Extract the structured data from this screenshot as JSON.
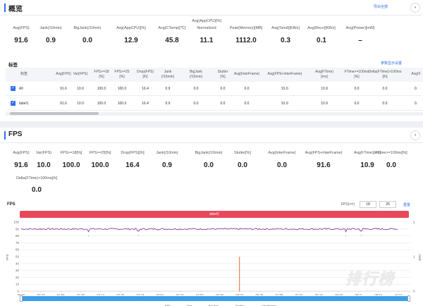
{
  "overview": {
    "title": "概览",
    "export_label": "导出全部",
    "collapse_icon": "chevron-down-icon",
    "metrics": [
      {
        "label": "Avg(FPS)",
        "value": "91.6"
      },
      {
        "label": "Jank(/10min)",
        "value": "0.9"
      },
      {
        "label": "BigJank(/10min)",
        "value": "0.0"
      },
      {
        "label": "Avg(AppCPU)[%]",
        "value": "12.9"
      },
      {
        "label": "Avg(CTemp)[℃]",
        "value": "45.8"
      },
      {
        "label": "Avg(AppCPU)[%]",
        "label2": "Normalized",
        "value": "11.1"
      },
      {
        "label": "Peak(Memory)[MB]",
        "value": "1112.0"
      },
      {
        "label": "Avg(Send)[KB/s]",
        "value": "0.3"
      },
      {
        "label": "Avg(Recv)[KB/s]",
        "value": "0.1"
      },
      {
        "label": "Avg(Power)[mW]",
        "value": "–"
      }
    ],
    "table": {
      "title": "标签",
      "settings_label": "参数显示设置",
      "headers": [
        [
          "标签"
        ],
        [
          "Avg(FPS)"
        ],
        [
          "Var(FPS)"
        ],
        [
          "FPS>=18",
          "[%]"
        ],
        [
          "FPS>=25",
          "[%]"
        ],
        [
          "Drop(FPS)",
          "[/h]"
        ],
        [
          "Jank",
          "(/10min)"
        ],
        [
          "BigJank",
          "(/10min)"
        ],
        [
          "Stutter",
          "[%]"
        ],
        [
          "Avg(InterFrame)"
        ],
        [
          "Avg(FPS+InterFrame)"
        ],
        [
          "Avg(FTime)",
          "[ms]"
        ],
        [
          "FTime>=100ms",
          "[%]"
        ],
        [
          "Delta(FTime)>100ms",
          "[/h]"
        ],
        [
          "Avg(F"
        ]
      ],
      "rows": [
        {
          "checked": true,
          "cells": [
            "All",
            "91.6",
            "10.0",
            "100.0",
            "100.0",
            "16.4",
            "0.9",
            "0.0",
            "0.0",
            "0.0",
            "91.6",
            "10.9",
            "0.0",
            "0.0",
            "0."
          ]
        },
        {
          "checked": true,
          "cells": [
            "label1",
            "91.6",
            "10.0",
            "100.0",
            "100.0",
            "16.4",
            "0.9",
            "0.0",
            "0.0",
            "0.0",
            "91.6",
            "10.9",
            "0.0",
            "0.0",
            "0."
          ]
        }
      ]
    }
  },
  "fps_section": {
    "title": "FPS",
    "collapse_icon": "chevron-down-icon",
    "metrics": [
      {
        "label": "Avg(FPS)",
        "value": "91.6"
      },
      {
        "label": "Var(FPS)",
        "value": "10.0"
      },
      {
        "label": "FPS>=18[%]",
        "value": "100.0"
      },
      {
        "label": "FPS>=25[%]",
        "value": "100.0"
      },
      {
        "label": "Drop(FPS)[/h]",
        "value": "16.4"
      },
      {
        "label": "Jank(/10min)",
        "value": "0.9"
      },
      {
        "label": "BigJank(/10min)",
        "value": "0.0"
      },
      {
        "label": "Stutter[%]",
        "value": "0.0"
      },
      {
        "label": "Avg(InterFrame)",
        "value": "0.0"
      },
      {
        "label": "Avg(FPS+InterFrame)",
        "value": "91.6"
      },
      {
        "label": "Avg(FTime)[ms]",
        "value": "10.9"
      },
      {
        "label": "FTime>=100ms[%]",
        "value": "0.0"
      },
      {
        "label": "Delta(FTime)>100ms[/h]",
        "value": "0.0"
      }
    ],
    "chart_controls": {
      "chart_label": "FPS",
      "fps_ge_label": "FPS(>=)",
      "fps_threshold_1": "18",
      "fps_threshold_2": "25",
      "reset_label": "重置",
      "label_bar": "label1"
    },
    "legend": [
      "FPS",
      "Jank",
      "BigJank",
      "Stutter",
      "InterFrame"
    ],
    "watermark": "排行榜"
  },
  "chart_data": {
    "type": "line",
    "title": "FPS",
    "xlabel": "",
    "ylabel": "FPS",
    "y2label": "Jank",
    "ylim": [
      0,
      100
    ],
    "y2lim": [
      0,
      2
    ],
    "yticks": [
      0,
      10,
      20,
      30,
      40,
      50,
      60,
      70,
      80,
      90,
      100
    ],
    "y2ticks": [
      0,
      1,
      2
    ],
    "x_ticks": [
      "00:00",
      "00:33",
      "01:06",
      "01:39",
      "02:12",
      "02:45",
      "03:18",
      "03:51",
      "04:24",
      "04:57",
      "05:30",
      "06:03",
      "06:36",
      "07:09",
      "07:42",
      "08:15",
      "08:48",
      "09:21",
      "09:54",
      "10:27"
    ],
    "grid": true,
    "series": [
      {
        "name": "FPS",
        "color": "#7b2d8e",
        "approx_level": 90,
        "dips": [
          {
            "t": "01:52",
            "v": 86
          },
          {
            "t": "03:15",
            "v": 87
          },
          {
            "t": "09:00",
            "v": 86
          },
          {
            "t": "09:25",
            "v": 87
          }
        ]
      },
      {
        "name": "Jank",
        "color": "#e86a2a",
        "events": [
          {
            "t": "06:03",
            "v": 1
          }
        ]
      }
    ],
    "colors": {
      "fps_line": "#7b2d8e",
      "jank_marker": "#e86a2a",
      "label_bar": "#e8495a",
      "range_slider": "#3aa0e8",
      "accent": "#2f6fed"
    }
  }
}
